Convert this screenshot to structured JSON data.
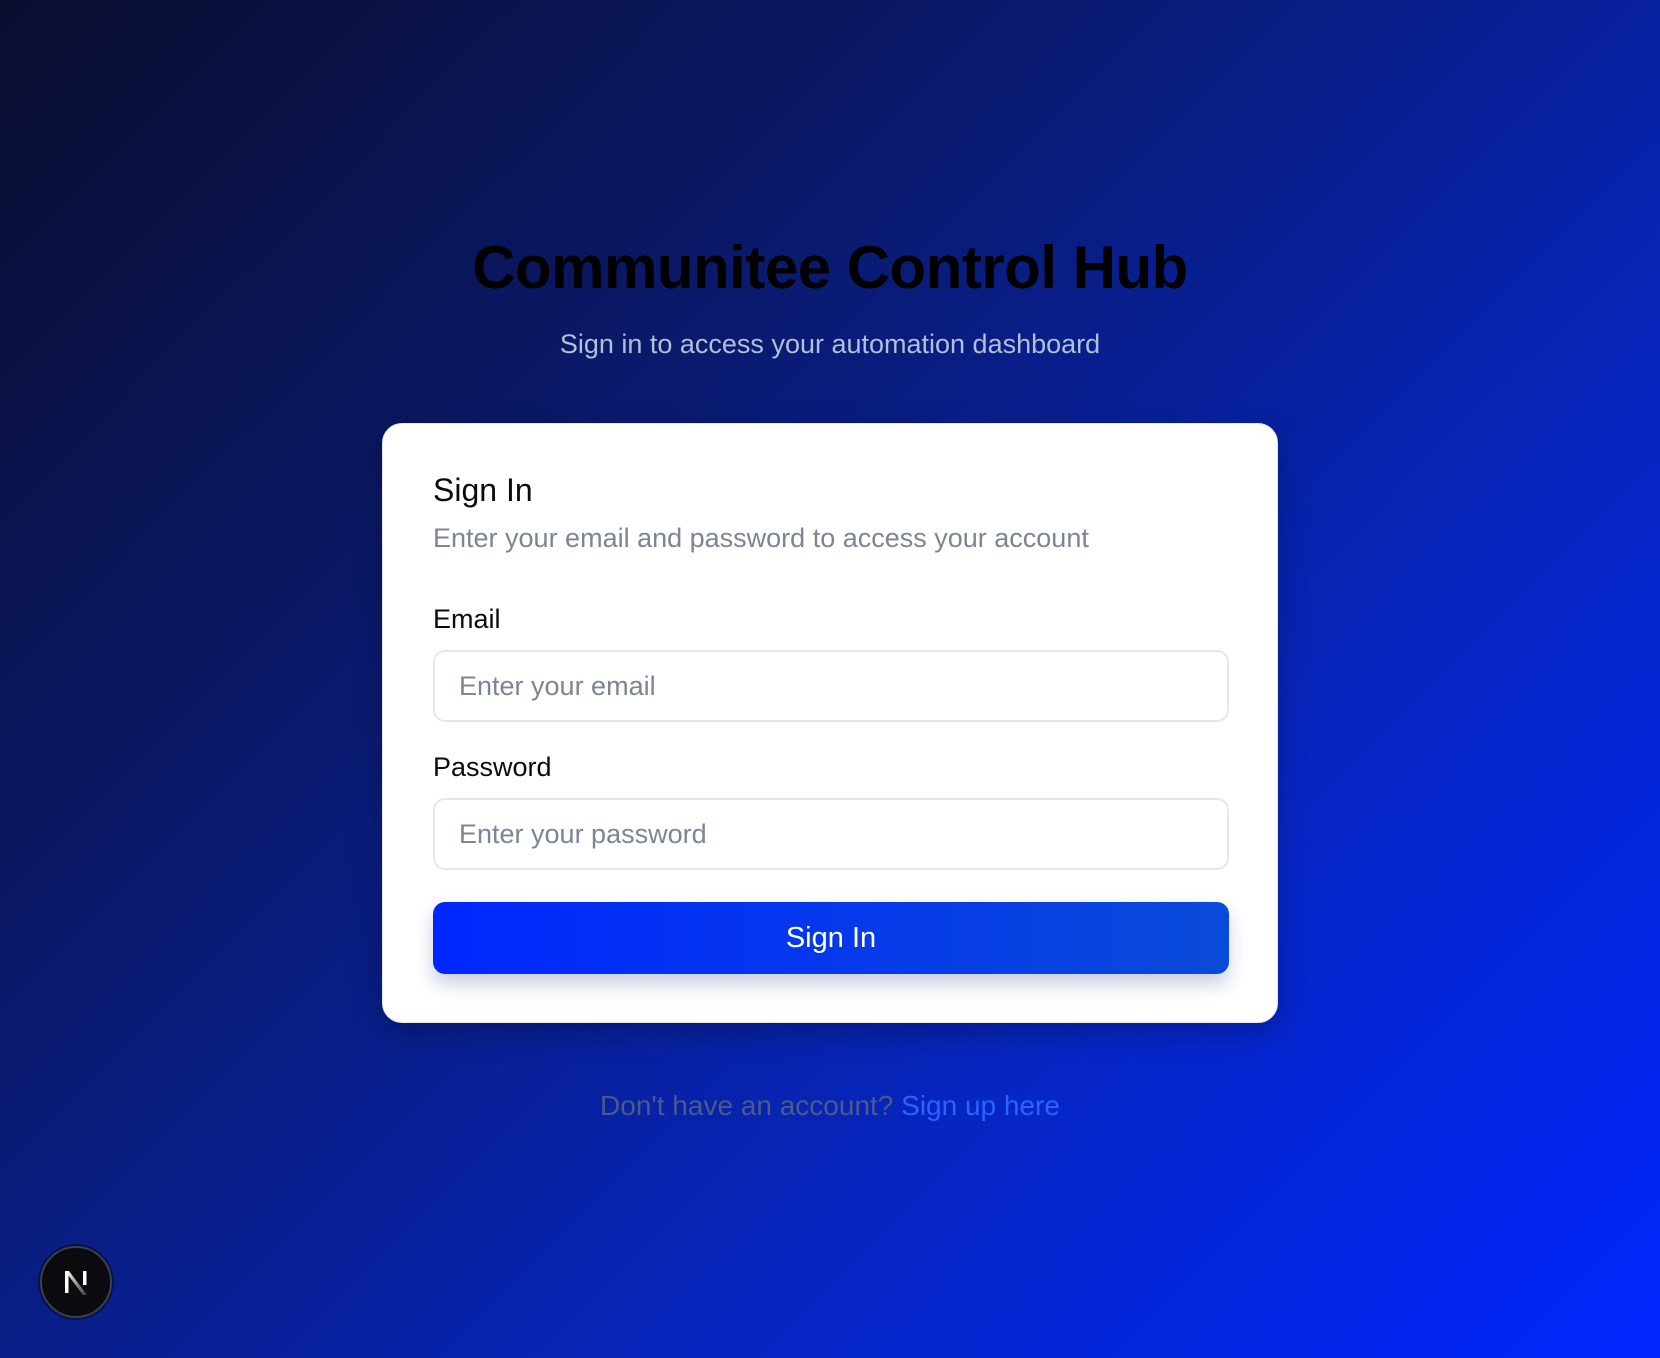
{
  "app": {
    "title": "Communitee Control Hub",
    "subtitle": "Sign in to access your automation dashboard"
  },
  "card": {
    "title": "Sign In",
    "description": "Enter your email and password to access your account",
    "email": {
      "label": "Email",
      "placeholder": "Enter your email",
      "value": ""
    },
    "password": {
      "label": "Password",
      "placeholder": "Enter your password",
      "value": ""
    },
    "submit_label": "Sign In"
  },
  "footer": {
    "prompt": "Don't have an account?",
    "link_label": "Sign up here"
  },
  "dev_badge": {
    "icon": "nextjs-logo-icon",
    "letter": "N"
  },
  "colors": {
    "background_start": "#0a0d2e",
    "background_end": "#0026ff",
    "button_start": "#0027ff",
    "button_end": "#0a4ad9",
    "link": "#2a63ff"
  }
}
